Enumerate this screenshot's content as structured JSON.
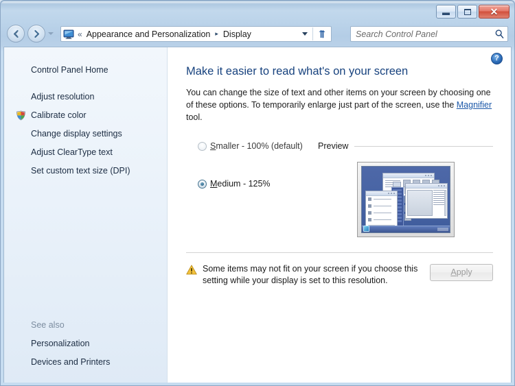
{
  "window": {
    "caption_buttons": {
      "minimize": "minimize",
      "maximize": "maximize",
      "close": "✕"
    }
  },
  "navigation": {
    "back_tooltip": "Back",
    "forward_tooltip": "Forward",
    "recent_pages_tooltip": "Recent pages",
    "breadcrumb": {
      "overflow": "«",
      "segments": [
        "Appearance and Personalization",
        "Display"
      ],
      "separator": "▸",
      "dropdown": "chevron-down",
      "refresh": "Refresh"
    }
  },
  "search": {
    "placeholder": "Search Control Panel",
    "value": ""
  },
  "sidebar": {
    "home_label": "Control Panel Home",
    "items": [
      {
        "label": "Adjust resolution",
        "icon": ""
      },
      {
        "label": "Calibrate color",
        "icon": "uac-shield-icon"
      },
      {
        "label": "Change display settings",
        "icon": ""
      },
      {
        "label": "Adjust ClearType text",
        "icon": ""
      },
      {
        "label": "Set custom text size (DPI)",
        "icon": ""
      }
    ],
    "see_also_heading": "See also",
    "see_also_items": [
      {
        "label": "Personalization"
      },
      {
        "label": "Devices and Printers"
      }
    ]
  },
  "main": {
    "help_glyph": "?",
    "title": "Make it easier to read what's on your screen",
    "description_part1": "You can change the size of text and other items on your screen by choosing one of these options. To temporarily enlarge just part of the screen, use the ",
    "description_link": "Magnifier",
    "description_part2": " tool.",
    "options": [
      {
        "label_prefix": "S",
        "label_rest": "maller - 100% (default)",
        "checked": false,
        "value": "100"
      },
      {
        "label_prefix": "M",
        "label_rest": "edium - 125%",
        "checked": true,
        "value": "125"
      }
    ],
    "preview_label": "Preview",
    "warning_text": "Some items may not fit on your screen if you choose this setting while your display is set to this resolution.",
    "apply_prefix": "A",
    "apply_rest": "pply",
    "apply_enabled": false
  },
  "colors": {
    "title_accent": "#17427e",
    "link": "#1a57a8",
    "frame": "#b4cde6",
    "sidebar_bg": "#eaf2fa",
    "warning_yellow": "#f2c13c",
    "close_red": "#d1503c",
    "radio_selected": "#2f6a8c"
  }
}
